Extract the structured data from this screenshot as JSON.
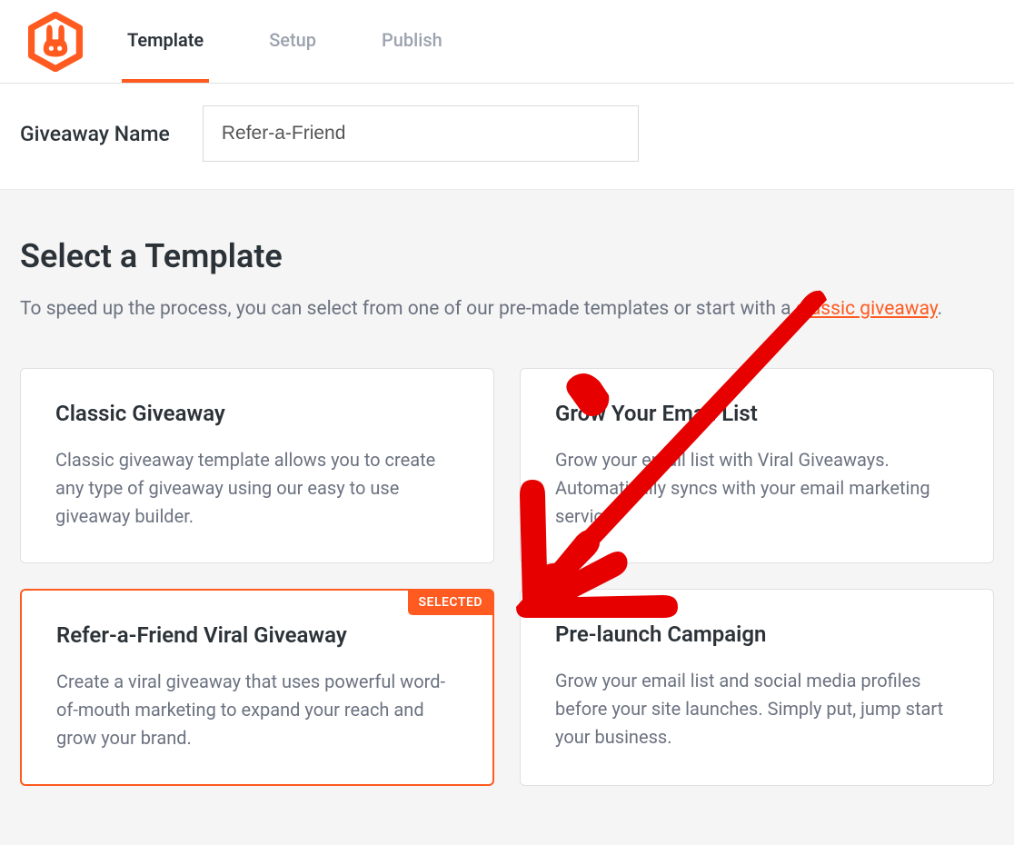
{
  "tabs": {
    "template": "Template",
    "setup": "Setup",
    "publish": "Publish"
  },
  "name_bar": {
    "label": "Giveaway Name",
    "value": "Refer-a-Friend"
  },
  "page": {
    "title": "Select a Template",
    "subtitle_prefix": "To speed up the process, you can select from one of our pre-made templates or start with a ",
    "subtitle_link": "classic giveaway",
    "subtitle_suffix": "."
  },
  "selected_badge": "SELECTED",
  "templates": [
    {
      "title": "Classic Giveaway",
      "desc": "Classic giveaway template allows you to create any type of giveaway using our easy to use giveaway builder."
    },
    {
      "title": "Grow Your Email List",
      "desc": "Grow your email list with Viral Giveaways. Automatically syncs with your email marketing service."
    },
    {
      "title": "Refer-a-Friend Viral Giveaway",
      "desc": "Create a viral giveaway that uses powerful word-of-mouth marketing to expand your reach and grow your brand."
    },
    {
      "title": "Pre-launch Campaign",
      "desc": "Grow your email list and social media profiles before your site launches. Simply put, jump start your business."
    }
  ]
}
